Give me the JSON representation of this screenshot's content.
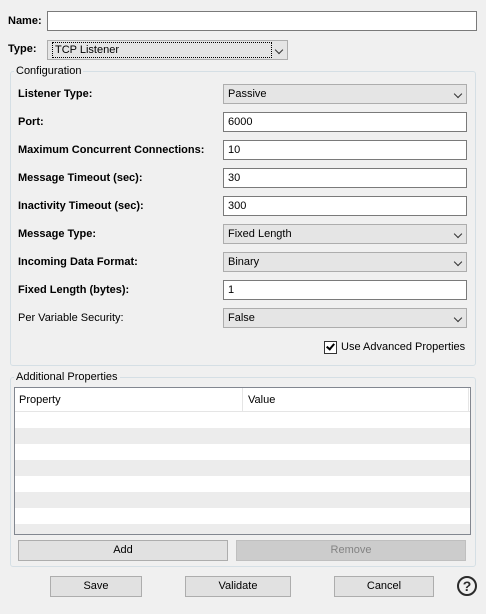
{
  "name_field": {
    "label": "Name:",
    "value": ""
  },
  "type_field": {
    "label": "Type:",
    "value": "TCP Listener"
  },
  "configuration": {
    "legend": "Configuration",
    "listener_type": {
      "label": "Listener Type:",
      "value": "Passive"
    },
    "port": {
      "label": "Port:",
      "value": "6000"
    },
    "max_connections": {
      "label": "Maximum Concurrent Connections:",
      "value": "10"
    },
    "message_timeout": {
      "label": "Message Timeout (sec):",
      "value": "30"
    },
    "inactivity_timeout": {
      "label": "Inactivity Timeout (sec):",
      "value": "300"
    },
    "message_type": {
      "label": "Message Type:",
      "value": "Fixed Length"
    },
    "incoming_format": {
      "label": "Incoming Data Format:",
      "value": "Binary"
    },
    "fixed_length": {
      "label": "Fixed Length (bytes):",
      "value": "1"
    },
    "per_variable_security": {
      "label": "Per Variable Security:",
      "value": "False"
    },
    "advanced": {
      "label": "Use Advanced Properties",
      "checked": true
    }
  },
  "additional": {
    "legend": "Additional Properties",
    "columns": [
      "Property",
      "Value"
    ],
    "add_label": "Add",
    "remove_label": "Remove"
  },
  "footer": {
    "save_label": "Save",
    "validate_label": "Validate",
    "cancel_label": "Cancel",
    "help_glyph": "?"
  },
  "colors": {
    "background": "#f0f0f0",
    "row_alt": "#ececec",
    "disabled_button": "#cccccc"
  }
}
